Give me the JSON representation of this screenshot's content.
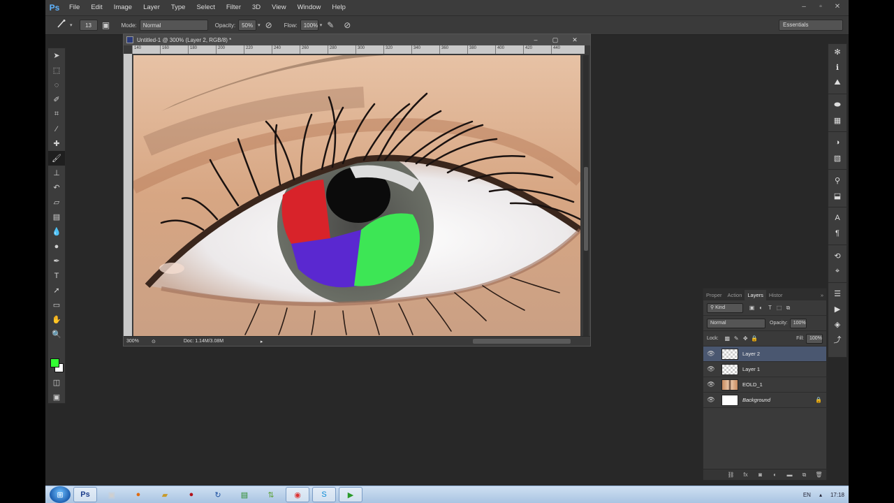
{
  "app": {
    "logo": "Ps",
    "menu": [
      "File",
      "Edit",
      "Image",
      "Layer",
      "Type",
      "Select",
      "Filter",
      "3D",
      "View",
      "Window",
      "Help"
    ],
    "window_controls": [
      "–",
      "▫",
      "✕"
    ]
  },
  "options_bar": {
    "brush_size": "13",
    "mode_label": "Mode:",
    "mode_value": "Normal",
    "opacity_label": "Opacity:",
    "opacity_value": "50%",
    "flow_label": "Flow:",
    "flow_value": "100%",
    "workspace": "Essentials"
  },
  "document": {
    "title": "Untitled-1 @ 300% (Layer 2, RGB/8) *",
    "ruler_ticks": [
      "140",
      "160",
      "180",
      "200",
      "220",
      "240",
      "260",
      "280",
      "300",
      "320",
      "340",
      "360",
      "380",
      "400",
      "420",
      "440"
    ],
    "zoom": "300%",
    "doc_size": "Doc: 1.14M/3.08M",
    "controls": [
      "–",
      "▢",
      "✕"
    ]
  },
  "layers_panel": {
    "tabs": [
      "Proper",
      "Action",
      "Layers",
      "Histor",
      "»"
    ],
    "active_tab": "Layers",
    "filter_kind": "Kind",
    "blend_mode": "Normal",
    "opacity_label": "Opacity:",
    "opacity_value": "100%",
    "lock_label": "Lock:",
    "fill_label": "Fill:",
    "fill_value": "100%",
    "layers": [
      {
        "name": "Layer 2",
        "selected": true
      },
      {
        "name": "Layer 1",
        "selected": false
      },
      {
        "name": "EOLD_1",
        "selected": false
      },
      {
        "name": "Background",
        "selected": false,
        "locked": true
      }
    ]
  },
  "colors": {
    "foreground": "#33ff33",
    "background": "#ffffff",
    "paint_red": "#d8232a",
    "paint_blue": "#5a28d0",
    "paint_green": "#3de655"
  },
  "taskbar": {
    "language": "EN",
    "time": "17:18"
  }
}
